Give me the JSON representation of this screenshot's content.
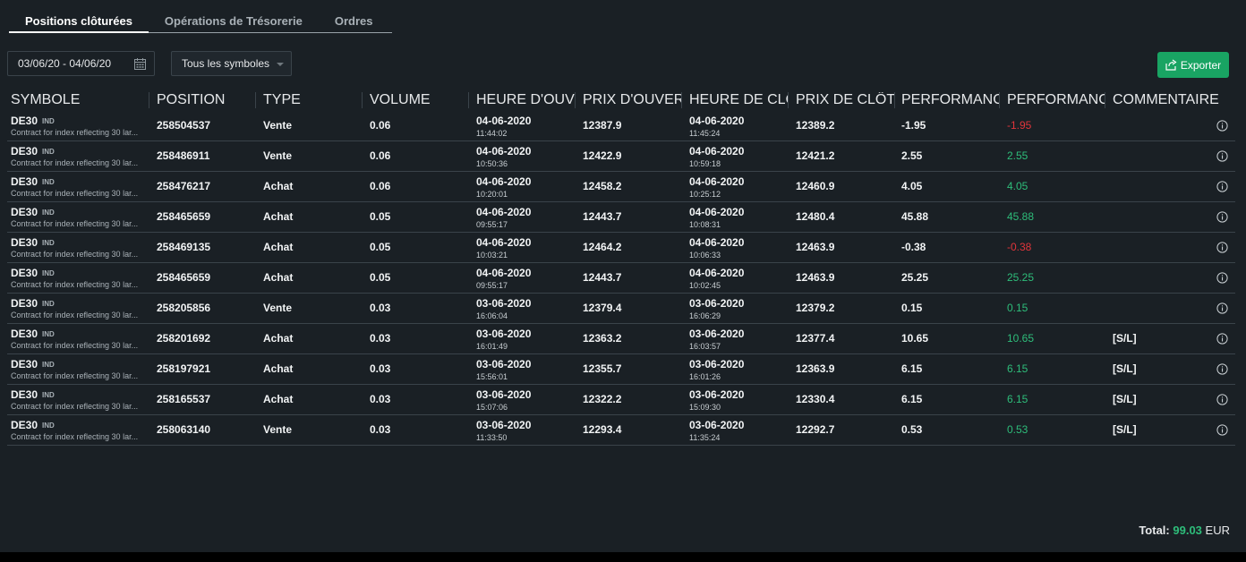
{
  "tabs": [
    {
      "label": "Positions clôturées",
      "active": true
    },
    {
      "label": "Opérations de Trésorerie",
      "active": false
    },
    {
      "label": "Ordres",
      "active": false
    }
  ],
  "filters": {
    "date_range": "03/06/20 - 04/06/20",
    "symbol_select": "Tous les symboles"
  },
  "export_label": "Exporter",
  "columns": [
    "SYMBOLE",
    "POSITION",
    "TYPE",
    "VOLUME",
    "HEURE D'OUVERTU...",
    "PRIX D'OUVERTURE",
    "HEURE DE CLÔTURE",
    "PRIX DE CLÔTURE",
    "PERFORMANCE B...",
    "PERFORMANCE N...",
    "COMMENTAIRE"
  ],
  "rows": [
    {
      "symbol": "DE30",
      "tag": "IND",
      "desc": "Contract for index reflecting 30 lar...",
      "position": "258504537",
      "type": "Vente",
      "volume": "0.06",
      "open_date": "04-06-2020",
      "open_time": "11:44:02",
      "open_price": "12387.9",
      "close_date": "04-06-2020",
      "close_time": "11:45:24",
      "close_price": "12389.2",
      "perf_b": "-1.95",
      "perf_n": "-1.95",
      "perf_sign": "neg",
      "comment": ""
    },
    {
      "symbol": "DE30",
      "tag": "IND",
      "desc": "Contract for index reflecting 30 lar...",
      "position": "258486911",
      "type": "Vente",
      "volume": "0.06",
      "open_date": "04-06-2020",
      "open_time": "10:50:36",
      "open_price": "12422.9",
      "close_date": "04-06-2020",
      "close_time": "10:59:18",
      "close_price": "12421.2",
      "perf_b": "2.55",
      "perf_n": "2.55",
      "perf_sign": "pos",
      "comment": ""
    },
    {
      "symbol": "DE30",
      "tag": "IND",
      "desc": "Contract for index reflecting 30 lar...",
      "position": "258476217",
      "type": "Achat",
      "volume": "0.06",
      "open_date": "04-06-2020",
      "open_time": "10:20:01",
      "open_price": "12458.2",
      "close_date": "04-06-2020",
      "close_time": "10:25:12",
      "close_price": "12460.9",
      "perf_b": "4.05",
      "perf_n": "4.05",
      "perf_sign": "pos",
      "comment": ""
    },
    {
      "symbol": "DE30",
      "tag": "IND",
      "desc": "Contract for index reflecting 30 lar...",
      "position": "258465659",
      "type": "Achat",
      "volume": "0.05",
      "open_date": "04-06-2020",
      "open_time": "09:55:17",
      "open_price": "12443.7",
      "close_date": "04-06-2020",
      "close_time": "10:08:31",
      "close_price": "12480.4",
      "perf_b": "45.88",
      "perf_n": "45.88",
      "perf_sign": "pos",
      "comment": ""
    },
    {
      "symbol": "DE30",
      "tag": "IND",
      "desc": "Contract for index reflecting 30 lar...",
      "position": "258469135",
      "type": "Achat",
      "volume": "0.05",
      "open_date": "04-06-2020",
      "open_time": "10:03:21",
      "open_price": "12464.2",
      "close_date": "04-06-2020",
      "close_time": "10:06:33",
      "close_price": "12463.9",
      "perf_b": "-0.38",
      "perf_n": "-0.38",
      "perf_sign": "neg",
      "comment": ""
    },
    {
      "symbol": "DE30",
      "tag": "IND",
      "desc": "Contract for index reflecting 30 lar...",
      "position": "258465659",
      "type": "Achat",
      "volume": "0.05",
      "open_date": "04-06-2020",
      "open_time": "09:55:17",
      "open_price": "12443.7",
      "close_date": "04-06-2020",
      "close_time": "10:02:45",
      "close_price": "12463.9",
      "perf_b": "25.25",
      "perf_n": "25.25",
      "perf_sign": "pos",
      "comment": ""
    },
    {
      "symbol": "DE30",
      "tag": "IND",
      "desc": "Contract for index reflecting 30 lar...",
      "position": "258205856",
      "type": "Vente",
      "volume": "0.03",
      "open_date": "03-06-2020",
      "open_time": "16:06:04",
      "open_price": "12379.4",
      "close_date": "03-06-2020",
      "close_time": "16:06:29",
      "close_price": "12379.2",
      "perf_b": "0.15",
      "perf_n": "0.15",
      "perf_sign": "pos",
      "comment": ""
    },
    {
      "symbol": "DE30",
      "tag": "IND",
      "desc": "Contract for index reflecting 30 lar...",
      "position": "258201692",
      "type": "Achat",
      "volume": "0.03",
      "open_date": "03-06-2020",
      "open_time": "16:01:49",
      "open_price": "12363.2",
      "close_date": "03-06-2020",
      "close_time": "16:03:57",
      "close_price": "12377.4",
      "perf_b": "10.65",
      "perf_n": "10.65",
      "perf_sign": "pos",
      "comment": "[S/L]"
    },
    {
      "symbol": "DE30",
      "tag": "IND",
      "desc": "Contract for index reflecting 30 lar...",
      "position": "258197921",
      "type": "Achat",
      "volume": "0.03",
      "open_date": "03-06-2020",
      "open_time": "15:56:01",
      "open_price": "12355.7",
      "close_date": "03-06-2020",
      "close_time": "16:01:26",
      "close_price": "12363.9",
      "perf_b": "6.15",
      "perf_n": "6.15",
      "perf_sign": "pos",
      "comment": "[S/L]"
    },
    {
      "symbol": "DE30",
      "tag": "IND",
      "desc": "Contract for index reflecting 30 lar...",
      "position": "258165537",
      "type": "Achat",
      "volume": "0.03",
      "open_date": "03-06-2020",
      "open_time": "15:07:06",
      "open_price": "12322.2",
      "close_date": "03-06-2020",
      "close_time": "15:09:30",
      "close_price": "12330.4",
      "perf_b": "6.15",
      "perf_n": "6.15",
      "perf_sign": "pos",
      "comment": "[S/L]"
    },
    {
      "symbol": "DE30",
      "tag": "IND",
      "desc": "Contract for index reflecting 30 lar...",
      "position": "258063140",
      "type": "Vente",
      "volume": "0.03",
      "open_date": "03-06-2020",
      "open_time": "11:33:50",
      "open_price": "12293.4",
      "close_date": "03-06-2020",
      "close_time": "11:35:24",
      "close_price": "12292.7",
      "perf_b": "0.53",
      "perf_n": "0.53",
      "perf_sign": "pos",
      "comment": "[S/L]"
    }
  ],
  "total": {
    "label": "Total:",
    "amount": "99.03",
    "currency": "EUR"
  },
  "colors": {
    "accent_green": "#19a463",
    "profit": "#2ebd7a",
    "loss": "#e0353b",
    "background": "#1a2025"
  },
  "icons": {
    "calendar": "calendar-icon",
    "export": "export-icon",
    "info": "info-icon",
    "dropdown": "chevron-down-icon"
  }
}
